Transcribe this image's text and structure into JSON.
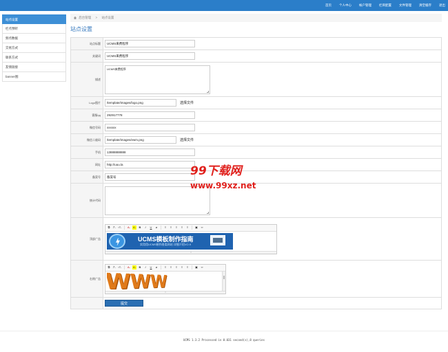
{
  "topnav": [
    "首页",
    "个人中心",
    "帐户管理",
    "栏目配置",
    "文件管理",
    "清空缓存",
    "退出"
  ],
  "sidebar": [
    "站点设置",
    "栏点预听",
    "频点数据",
    "交易方式",
    "联系方式",
    "友情链接",
    "banner图"
  ],
  "breadcrumb": {
    "parent": "后台管理",
    "current": "站点设置",
    "separator": ">"
  },
  "page_title": "站点设置",
  "form": {
    "site_title": {
      "label": "站点标题",
      "value": "UCMS来费程序"
    },
    "keywords": {
      "label": "关键词",
      "value": "UCMS来费程序"
    },
    "description": {
      "label": "描述",
      "value": "UCMS来费程序"
    },
    "logo": {
      "label": "Logo图片",
      "value": "/template/images/logo.png",
      "button": "选择文件"
    },
    "qq": {
      "label": "客服qq",
      "value": "292917778"
    },
    "wechat": {
      "label": "微信号码",
      "value": "xxxxxx"
    },
    "wechat_qr": {
      "label": "微信二维码",
      "value": "/template/images/ewm.png",
      "button": "选择文件"
    },
    "phone": {
      "label": "手机",
      "value": "13888888888"
    },
    "website": {
      "label": "网址",
      "value": "http://uuu.la"
    },
    "icp": {
      "label": "备案号",
      "value": "备案号"
    },
    "stats_code": {
      "label": "统计代码",
      "value": ""
    },
    "top_ad": {
      "label": "顶部广告",
      "banner_title": "UCMS模板制作指南",
      "banner_sub": "实用用UCMS制作各类网站 详细介绍VO.9"
    },
    "right_ad": {
      "label": "右侧广告",
      "image_text": "WWW"
    },
    "submit": "提交"
  },
  "editor_toolbar": [
    "⧉",
    "ℱ-",
    "ₜT-",
    "A-",
    "A-",
    "B",
    "I",
    "U",
    "⌀",
    "≡",
    "≡",
    "≡",
    "≡",
    "≡",
    "▣",
    "∞"
  ],
  "footer": "UCMS 1.3.2  Processed in 0.031 second(s),8 queries",
  "watermark": {
    "big": "99下载网",
    "small": "www.99xz.net"
  }
}
